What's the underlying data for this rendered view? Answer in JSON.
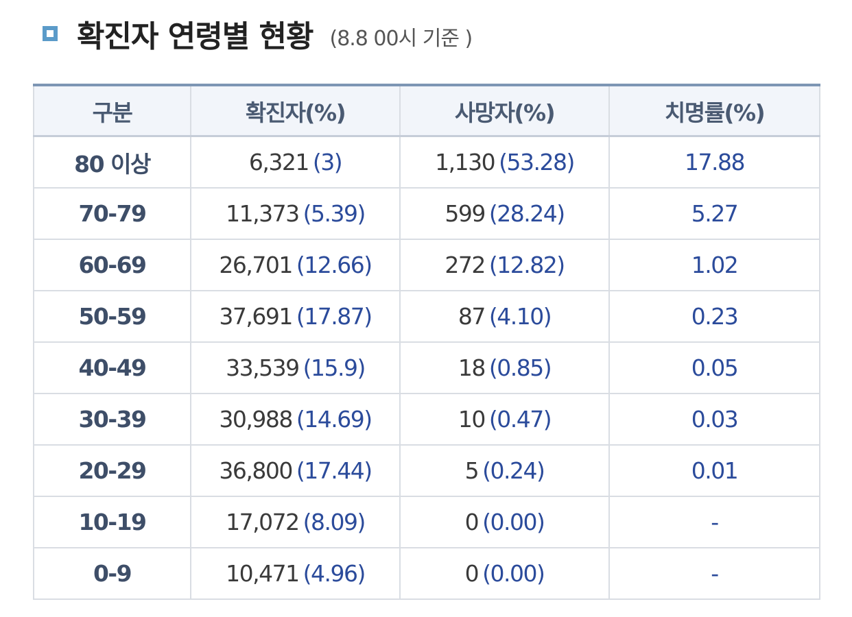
{
  "header": {
    "title": "확진자 연령별 현황",
    "subtitle": "(8.8 00시 기준 )"
  },
  "table": {
    "columns": [
      "구분",
      "확진자(%)",
      "사망자(%)",
      "치명률(%)"
    ],
    "rows": [
      {
        "age": "80 이상",
        "confirmed": "6,321",
        "confirmed_pct": "(3)",
        "deaths": "1,130",
        "deaths_pct": "(53.28)",
        "fatality": "17.88"
      },
      {
        "age": "70-79",
        "confirmed": "11,373",
        "confirmed_pct": "(5.39)",
        "deaths": "599",
        "deaths_pct": "(28.24)",
        "fatality": "5.27"
      },
      {
        "age": "60-69",
        "confirmed": "26,701",
        "confirmed_pct": "(12.66)",
        "deaths": "272",
        "deaths_pct": "(12.82)",
        "fatality": "1.02"
      },
      {
        "age": "50-59",
        "confirmed": "37,691",
        "confirmed_pct": "(17.87)",
        "deaths": "87",
        "deaths_pct": "(4.10)",
        "fatality": "0.23"
      },
      {
        "age": "40-49",
        "confirmed": "33,539",
        "confirmed_pct": "(15.9)",
        "deaths": "18",
        "deaths_pct": "(0.85)",
        "fatality": "0.05"
      },
      {
        "age": "30-39",
        "confirmed": "30,988",
        "confirmed_pct": "(14.69)",
        "deaths": "10",
        "deaths_pct": "(0.47)",
        "fatality": "0.03"
      },
      {
        "age": "20-29",
        "confirmed": "36,800",
        "confirmed_pct": "(17.44)",
        "deaths": "5",
        "deaths_pct": "(0.24)",
        "fatality": "0.01"
      },
      {
        "age": "10-19",
        "confirmed": "17,072",
        "confirmed_pct": "(8.09)",
        "deaths": "0",
        "deaths_pct": "(0.00)",
        "fatality": "-"
      },
      {
        "age": "0-9",
        "confirmed": "10,471",
        "confirmed_pct": "(4.96)",
        "deaths": "0",
        "deaths_pct": "(0.00)",
        "fatality": "-"
      }
    ]
  },
  "colors": {
    "title_square": "#5b9bc9",
    "header_bg": "#f2f5fa",
    "table_top_border": "#7d96b4",
    "percent_text": "#2b4b9b",
    "age_text": "#3e4e68"
  }
}
